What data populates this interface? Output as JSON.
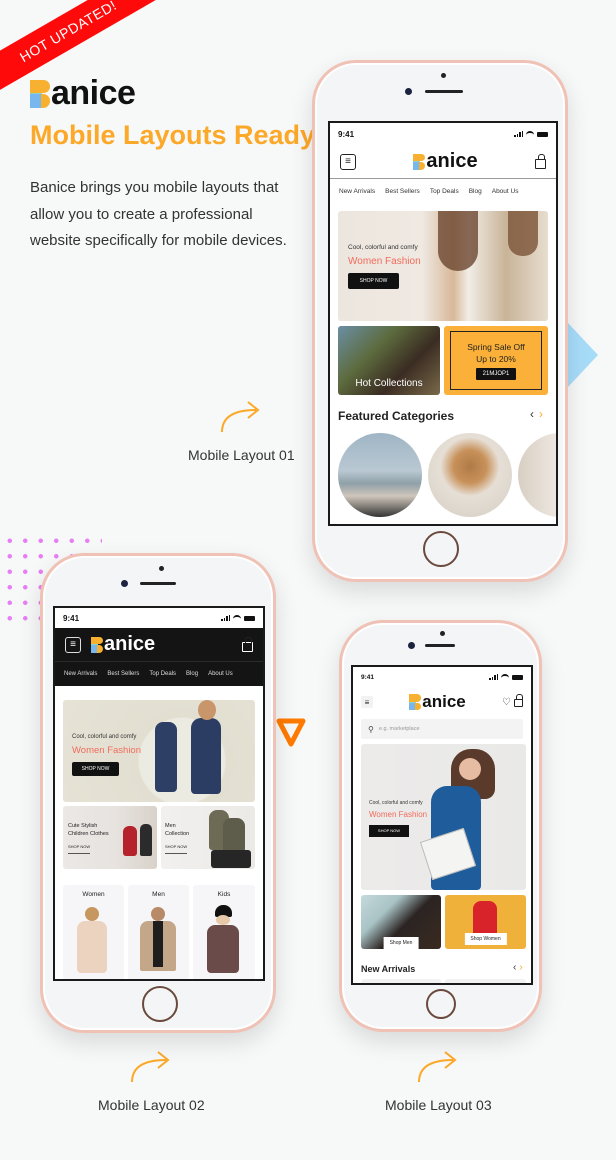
{
  "ribbon": {
    "label": "HOT UPDATED!"
  },
  "hero": {
    "brand": "anice",
    "brand_initial": "B",
    "headline": "Mobile Layouts Ready!",
    "description": "Banice brings you mobile layouts that allow you to create a professional website specifically for mobile devices."
  },
  "colors": {
    "accent": "#fca828",
    "ribbon": "#ff0a0a",
    "sale": "#f26b5b",
    "phone_frame": "#f0c1b5"
  },
  "captions": {
    "layout1": "Mobile Layout 01",
    "layout2": "Mobile Layout 02",
    "layout3": "Mobile Layout 03"
  },
  "layout1": {
    "time": "9:41",
    "logo": "anice",
    "nav": [
      "New Arrivals",
      "Best Sellers",
      "Top Deals",
      "Blog",
      "About Us"
    ],
    "banner": {
      "subtitle": "Cool, colorful and comfy",
      "title": "Women Fashion",
      "button": "SHOP NOW"
    },
    "hot_collections": "Hot Collections",
    "promo": {
      "line1": "Spring Sale Off",
      "line2": "Up to 20%",
      "code": "21MJOP1"
    },
    "featured_title": "Featured Categories",
    "prev_icon": "‹",
    "next_icon": "›"
  },
  "layout2": {
    "time": "9:41",
    "logo": "anice",
    "nav": [
      "New Arrivals",
      "Best Sellers",
      "Top Deals",
      "Blog",
      "About Us"
    ],
    "banner": {
      "subtitle": "Cool, colorful and comfy",
      "title": "Women Fashion",
      "button": "SHOP NOW"
    },
    "promo_children": {
      "title_line1": "Cute Stylish",
      "title_line2": "Children Clothes",
      "link": "SHOP NOW"
    },
    "promo_men": {
      "title_line1": "Men",
      "title_line2": "Collection",
      "link": "SHOP NOW"
    },
    "categories": [
      "Women",
      "Men",
      "Kids"
    ]
  },
  "layout3": {
    "time": "9:41",
    "logo": "anice",
    "search_placeholder": "e.g. marketplace",
    "banner": {
      "subtitle": "Cool, colorful and comfy",
      "title": "Women Fashion",
      "button": "SHOP NOW"
    },
    "shop_men": "Shop Men",
    "shop_women": "Shop Women",
    "new_arrivals": "New Arrivals",
    "prev_icon": "‹",
    "next_icon": "›"
  }
}
